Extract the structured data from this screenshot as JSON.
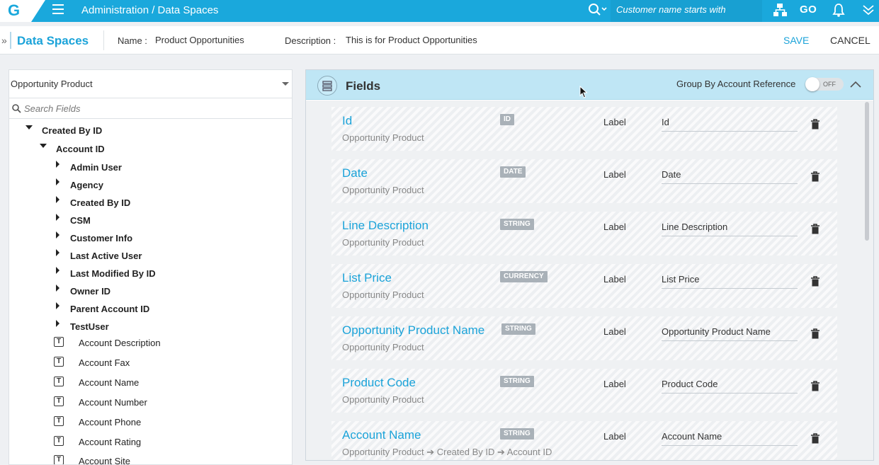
{
  "topbar": {
    "logo_letter": "G",
    "breadcrumb": "Administration / Data Spaces",
    "search_placeholder": "Customer name starts with",
    "go_label": "GO",
    "brand_color": "#1aa8dc"
  },
  "subheader": {
    "title": "Data Spaces",
    "name_label": "Name :",
    "name_value": "Product Opportunities",
    "description_label": "Description :",
    "description_value": "This is for Product Opportunities",
    "save_label": "SAVE",
    "cancel_label": "CANCEL"
  },
  "left_panel": {
    "object_selected": "Opportunity Product",
    "search_placeholder": "Search Fields",
    "tree": {
      "created_by_id": "Created By ID",
      "account_id": "Account ID",
      "lookups": [
        "Admin User",
        "Agency",
        "Created By ID",
        "CSM",
        "Customer Info",
        "Last Active User",
        "Last Modified By ID",
        "Owner ID",
        "Parent Account ID",
        "TestUser"
      ],
      "field_type_glyph": "T",
      "fields": [
        "Account Description",
        "Account Fax",
        "Account Name",
        "Account Number",
        "Account Phone",
        "Account Rating",
        "Account Site"
      ]
    }
  },
  "fields_panel": {
    "title": "Fields",
    "group_by_label": "Group By Account Reference",
    "toggle_state": "OFF",
    "label_caption": "Label",
    "cards": [
      {
        "name": "Id",
        "source": "Opportunity Product",
        "type": "ID",
        "label": "Id"
      },
      {
        "name": "Date",
        "source": "Opportunity Product",
        "type": "DATE",
        "label": "Date"
      },
      {
        "name": "Line Description",
        "source": "Opportunity Product",
        "type": "STRING",
        "label": "Line Description"
      },
      {
        "name": "List Price",
        "source": "Opportunity Product",
        "type": "CURRENCY",
        "label": "List Price"
      },
      {
        "name": "Opportunity Product Name",
        "source": "Opportunity Product",
        "type": "STRING",
        "label": "Opportunity Product Name"
      },
      {
        "name": "Product Code",
        "source": "Opportunity Product",
        "type": "STRING",
        "label": "Product Code"
      },
      {
        "name": "Account Name",
        "source": "Opportunity Product ➔ Created By ID ➔ Account ID",
        "type": "STRING",
        "label": "Account Name"
      }
    ]
  }
}
